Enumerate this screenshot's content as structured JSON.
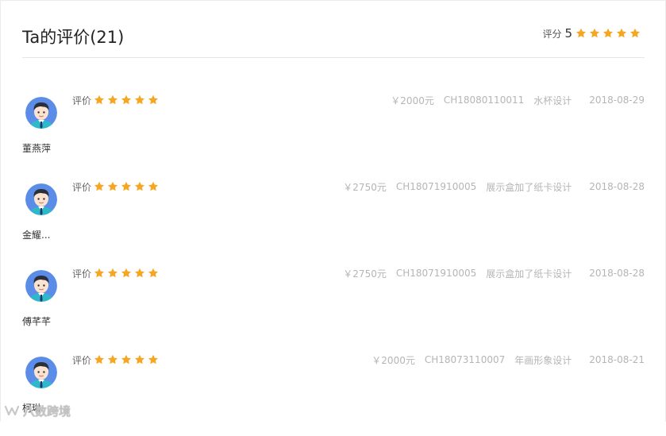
{
  "header": {
    "title": "Ta的评价(21)",
    "score_label": "评分",
    "score_value": "5",
    "stars": 5
  },
  "colors": {
    "star": "#f7a623",
    "avatar_bg": "#5b8de8",
    "meta_text": "#b5b5b5"
  },
  "reviews": [
    {
      "name": "董燕萍",
      "rating_label": "评价",
      "stars": 5,
      "price": "￥2000元",
      "order_no": "CH18080110011",
      "service": "水杯设计",
      "date": "2018-08-29"
    },
    {
      "name": "金耀...",
      "rating_label": "评价",
      "stars": 5,
      "price": "￥2750元",
      "order_no": "CH18071910005",
      "service": "展示盒加了纸卡设计",
      "date": "2018-08-28"
    },
    {
      "name": "傅芊芊",
      "rating_label": "评价",
      "stars": 5,
      "price": "￥2750元",
      "order_no": "CH18071910005",
      "service": "展示盒加了纸卡设计",
      "date": "2018-08-28"
    },
    {
      "name": "柯琳",
      "rating_label": "评价",
      "stars": 5,
      "price": "￥2000元",
      "order_no": "CH18073110007",
      "service": "年画形象设计",
      "date": "2018-08-21"
    }
  ],
  "watermark": {
    "text": "八数跨境",
    "icon": "brand-logo-icon"
  }
}
